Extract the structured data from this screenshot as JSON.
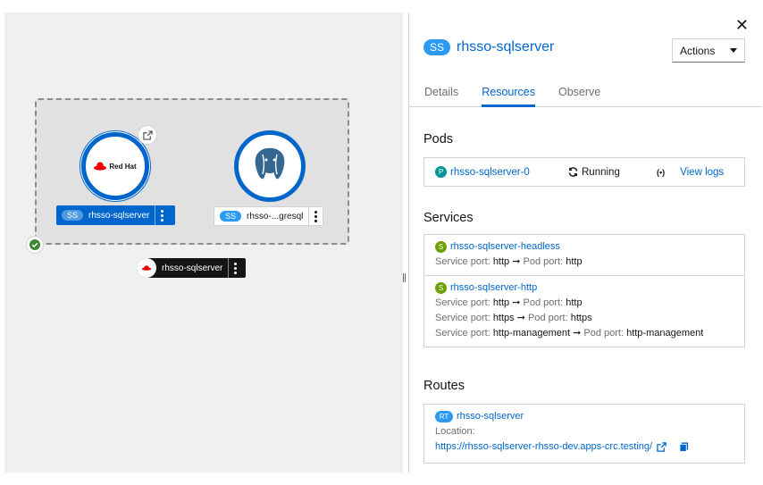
{
  "topology": {
    "group_label": "rhsso-sqlserver",
    "nodes": [
      {
        "badge": "SS",
        "label": "rhsso-sqlserver",
        "logo_text": "Red Hat"
      },
      {
        "badge": "SS",
        "label": "rhsso-...gresql"
      }
    ]
  },
  "panel": {
    "close_glyph": "✕",
    "badge": "SS",
    "title": "rhsso-sqlserver",
    "actions_label": "Actions",
    "tabs": [
      "Details",
      "Resources",
      "Observe"
    ],
    "active_tab": "Resources",
    "pods": {
      "heading": "Pods",
      "badge": "P",
      "name": "rhsso-sqlserver-0",
      "status": "Running",
      "logs_label": "View logs"
    },
    "services": {
      "heading": "Services",
      "items": [
        {
          "badge": "S",
          "name": "rhsso-sqlserver-headless",
          "ports": [
            {
              "service_label": "Service port:",
              "service_port": "http",
              "pod_label": "Pod port:",
              "pod_port": "http"
            }
          ]
        },
        {
          "badge": "S",
          "name": "rhsso-sqlserver-http",
          "ports": [
            {
              "service_label": "Service port:",
              "service_port": "http",
              "pod_label": "Pod port:",
              "pod_port": "http"
            },
            {
              "service_label": "Service port:",
              "service_port": "https",
              "pod_label": "Pod port:",
              "pod_port": "https"
            },
            {
              "service_label": "Service port:",
              "service_port": "http-management",
              "pod_label": "Pod port:",
              "pod_port": "http-management"
            }
          ]
        }
      ]
    },
    "routes": {
      "heading": "Routes",
      "badge": "RT",
      "name": "rhsso-sqlserver",
      "location_label": "Location:",
      "url": "https://rhsso-sqlserver-rhsso-dev.apps-crc.testing/"
    }
  },
  "colors": {
    "accent": "#0066cc",
    "ss_badge": "#2b9af3",
    "pod_badge": "#009596",
    "service_badge": "#6ca100",
    "route_badge": "#2b9af3",
    "success": "#3e8635"
  },
  "icons": [
    "close-icon",
    "caret-down-icon",
    "sync-icon",
    "wifi-icon",
    "external-link-icon",
    "copy-icon",
    "check-circle-icon",
    "kebab-icon",
    "redhat-logo",
    "postgresql-logo"
  ]
}
